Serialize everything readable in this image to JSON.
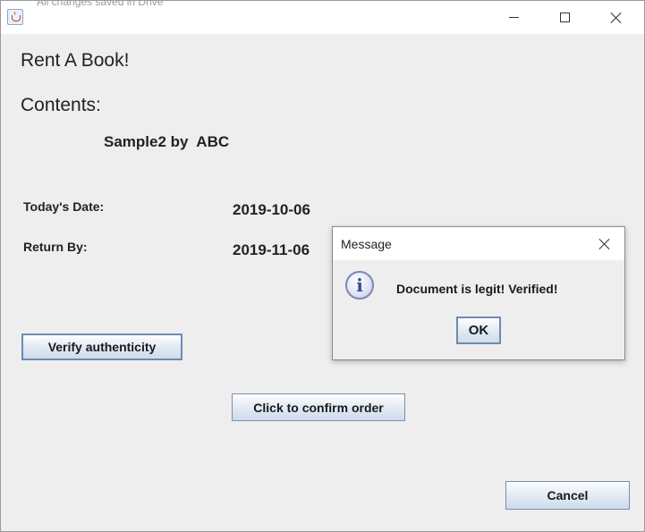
{
  "window": {
    "title_peek": "All changes saved in Drive",
    "controls": {
      "minimize": "minimize-icon",
      "maximize": "maximize-icon",
      "close": "close-icon"
    }
  },
  "form": {
    "heading": "Rent A Book!",
    "contents_label": "Contents:",
    "book": "Sample2 by  ABC",
    "todays_date_label": "Today's Date:",
    "todays_date_value": "2019-10-06",
    "return_by_label": "Return By:",
    "return_by_value": "2019-11-06",
    "verify_button": "Verify authenticity",
    "confirm_button": "Click to confirm order",
    "cancel_button": "Cancel"
  },
  "dialog": {
    "title": "Message",
    "icon": "info-icon",
    "message": "Document is legit! Verified!",
    "ok_button": "OK"
  },
  "colors": {
    "window_bg": "#eeeeee",
    "button_border": "#7a8ea6",
    "info_icon": "#3a4a9a"
  }
}
